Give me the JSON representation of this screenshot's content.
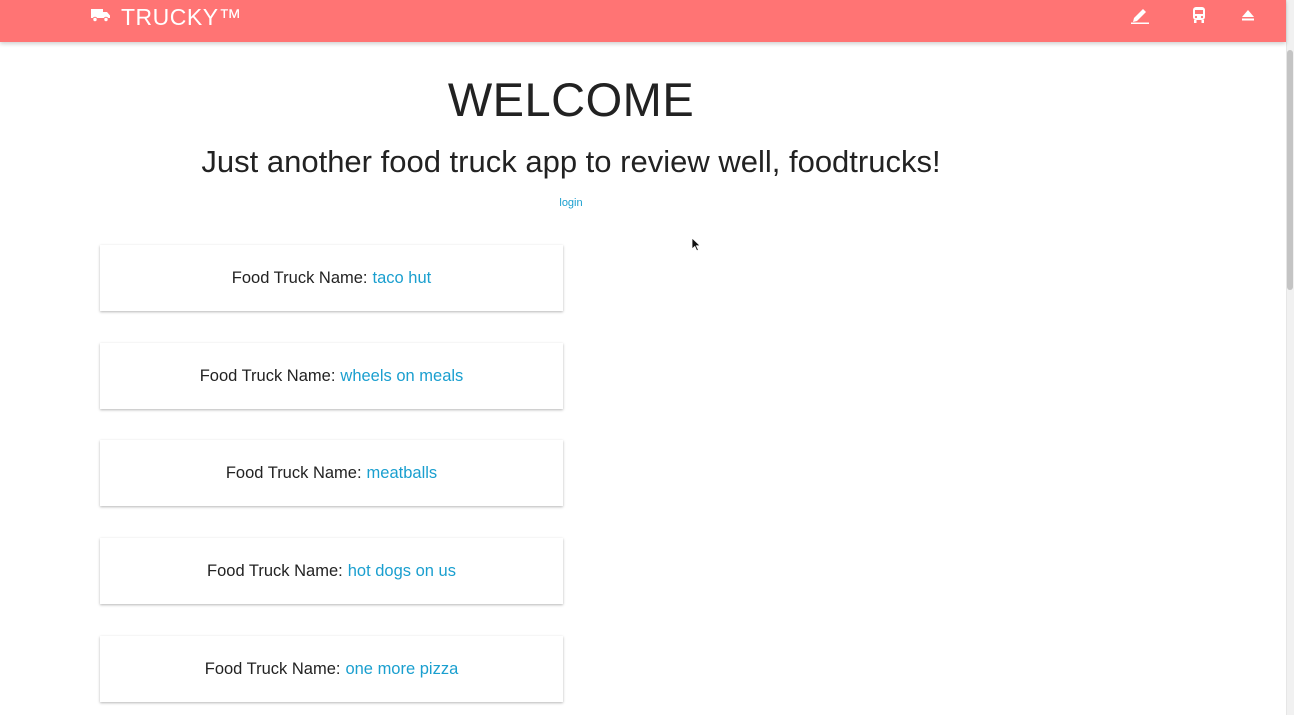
{
  "app": {
    "brand_title": "TRUCKY™",
    "brand_icon": "truck-icon",
    "colors": {
      "navbar": "#ff7474",
      "link": "#1a9fcf",
      "text": "#222222"
    },
    "nav_icons": [
      "edit-icon",
      "bus-icon",
      "eject-icon"
    ]
  },
  "hero": {
    "title": "WELCOME",
    "subtitle": "Just another food truck app to review well, foodtrucks!",
    "login_label": "login"
  },
  "trucks": {
    "label": "Food Truck Name:",
    "names": [
      "taco hut",
      "wheels on meals",
      "meatballs",
      "hot dogs on us",
      "one more pizza"
    ]
  }
}
